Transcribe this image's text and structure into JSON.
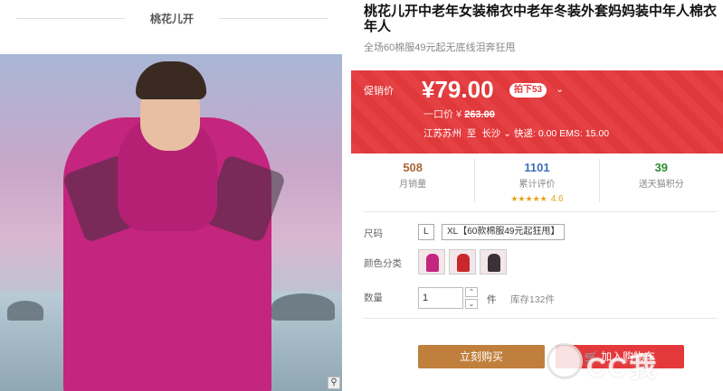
{
  "shop": {
    "name": "桃花儿开"
  },
  "product": {
    "title": "桃花儿开中老年女装棉衣中老年冬装外套妈妈装中年人棉衣年人",
    "subtitle": "全场60棉服49元起无底线泪奔狂甩"
  },
  "price": {
    "promo_label": "促销价",
    "current": "¥79.00",
    "discount_badge": "拍下53",
    "original_label": "一口价 ¥",
    "original_value": "263.00",
    "ship_from": "江苏苏州",
    "ship_to_word": "至",
    "ship_to": "长沙",
    "shipping": "快递: 0.00 EMS: 15.00"
  },
  "stats": {
    "sales_num": "508",
    "sales_label": "月销量",
    "reviews_num": "1101",
    "reviews_label": "累计评价",
    "rating": "4.6",
    "points_num": "39",
    "points_label": "送天猫积分"
  },
  "options": {
    "size_label": "尺码",
    "size_values": [
      "L",
      "XL【60款棉服49元起狂甩】"
    ],
    "color_label": "颜色分类",
    "colors": [
      "#c4257e",
      "#c8282c",
      "#3a3238"
    ],
    "qty_label": "数量",
    "qty_value": "1",
    "unit": "件",
    "stock": "库存132件"
  },
  "actions": {
    "buy_now": "立刻购买",
    "add_cart": "加入购物车"
  },
  "watermark": {
    "text": "CC我"
  },
  "icons": [
    "zoom-icon",
    "chevron-down-icon",
    "star-icon",
    "cart-icon",
    "arrow-up-icon",
    "arrow-down-icon"
  ]
}
